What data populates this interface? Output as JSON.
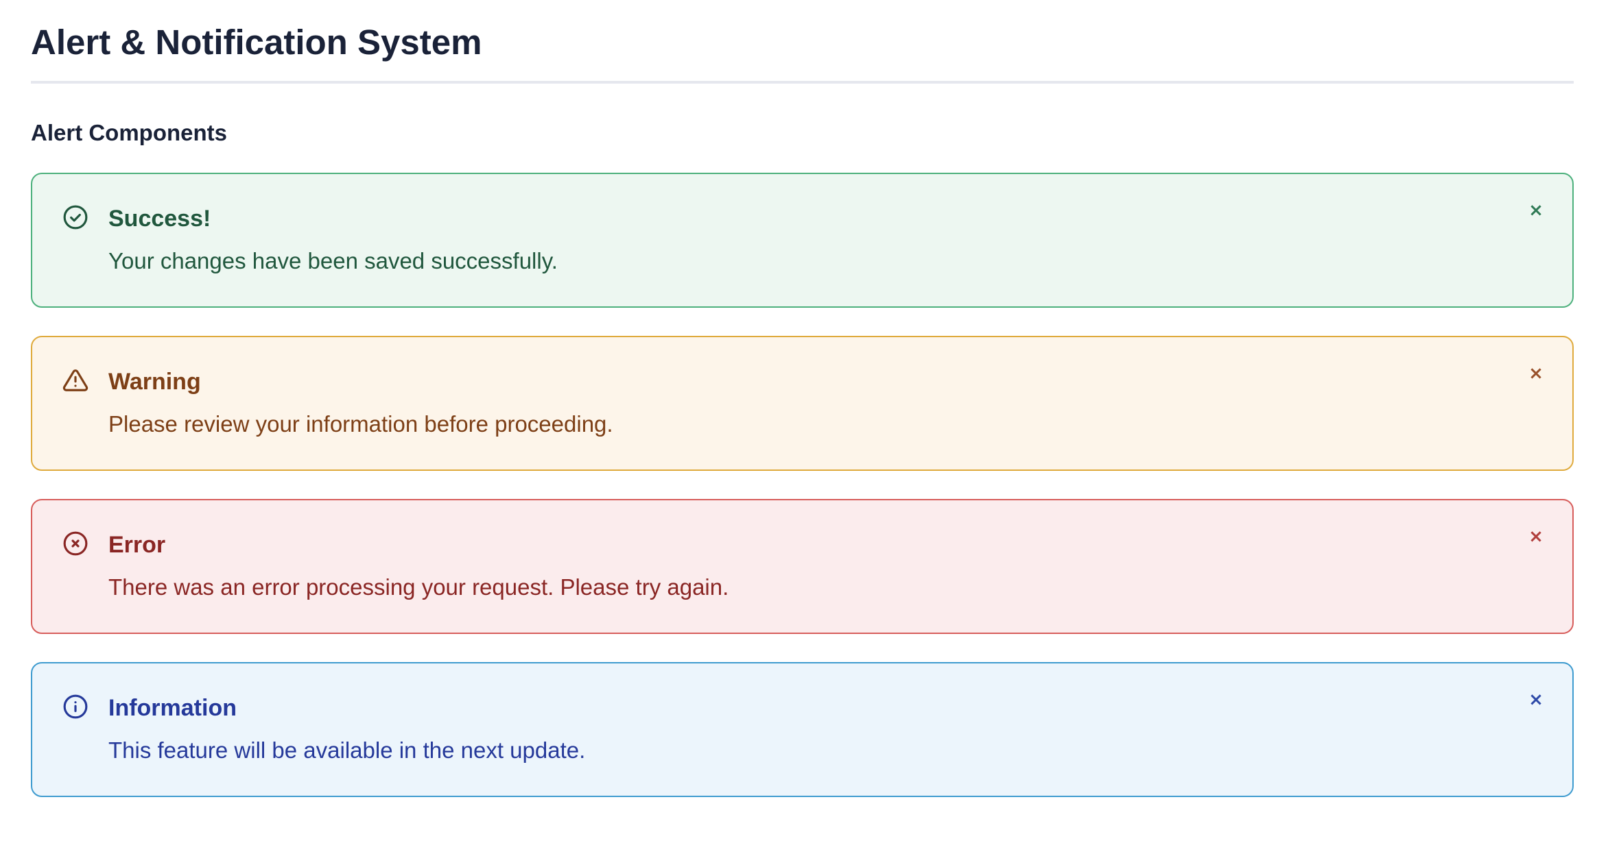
{
  "page": {
    "title": "Alert & Notification System",
    "section_title": "Alert Components"
  },
  "alerts": [
    {
      "type": "success",
      "icon": "check-circle-icon",
      "title": "Success!",
      "message": "Your changes have been saved successfully.",
      "close_label": "×",
      "colors": {
        "background": "#edf7f1",
        "border": "#4cb07c",
        "text": "#20573d"
      }
    },
    {
      "type": "warning",
      "icon": "warning-triangle-icon",
      "title": "Warning",
      "message": "Please review your information before proceeding.",
      "close_label": "×",
      "colors": {
        "background": "#fdf5ea",
        "border": "#dfaa3c",
        "text": "#7d3f16"
      }
    },
    {
      "type": "error",
      "icon": "x-circle-icon",
      "title": "Error",
      "message": "There was an error processing your request. Please try again.",
      "close_label": "×",
      "colors": {
        "background": "#fbeced",
        "border": "#d75c5a",
        "text": "#8a2624"
      }
    },
    {
      "type": "info",
      "icon": "info-circle-icon",
      "title": "Information",
      "message": "This feature will be available in the next update.",
      "close_label": "×",
      "colors": {
        "background": "#ecf5fc",
        "border": "#3e9bcf",
        "text": "#25399a"
      }
    }
  ]
}
